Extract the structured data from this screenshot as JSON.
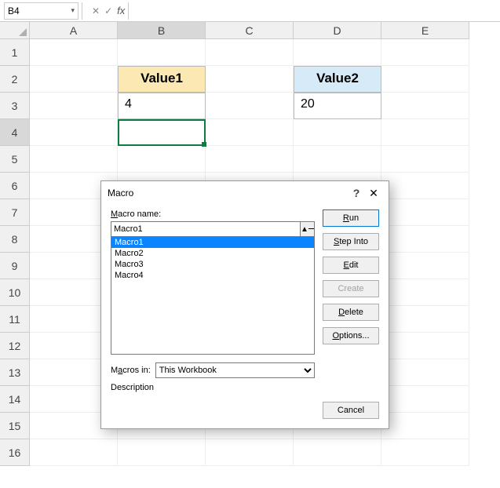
{
  "formulaBar": {
    "nameBox": "B4",
    "cancelIcon": "✕",
    "confirmIcon": "✓",
    "fxLabel": "fx"
  },
  "columns": [
    "A",
    "B",
    "C",
    "D",
    "E"
  ],
  "rows": [
    "1",
    "2",
    "3",
    "4",
    "5",
    "6",
    "7",
    "8",
    "9",
    "10",
    "11",
    "12",
    "13",
    "14",
    "15",
    "16"
  ],
  "cells": {
    "B2": "Value1",
    "D2": "Value2",
    "B3": "4",
    "D3": "20"
  },
  "dialog": {
    "title": "Macro",
    "helpIcon": "?",
    "closeIcon": "✕",
    "nameLabel": "Macro name:",
    "nameValue": "Macro1",
    "list": [
      "Macro1",
      "Macro2",
      "Macro3",
      "Macro4"
    ],
    "macrosInLabel": "Macros in:",
    "macrosInValue": "This Workbook",
    "descriptionLabel": "Description",
    "buttons": {
      "run": "Run",
      "stepInto": "Step Into",
      "edit": "Edit",
      "create": "Create",
      "delete": "Delete",
      "options": "Options...",
      "cancel": "Cancel"
    }
  }
}
